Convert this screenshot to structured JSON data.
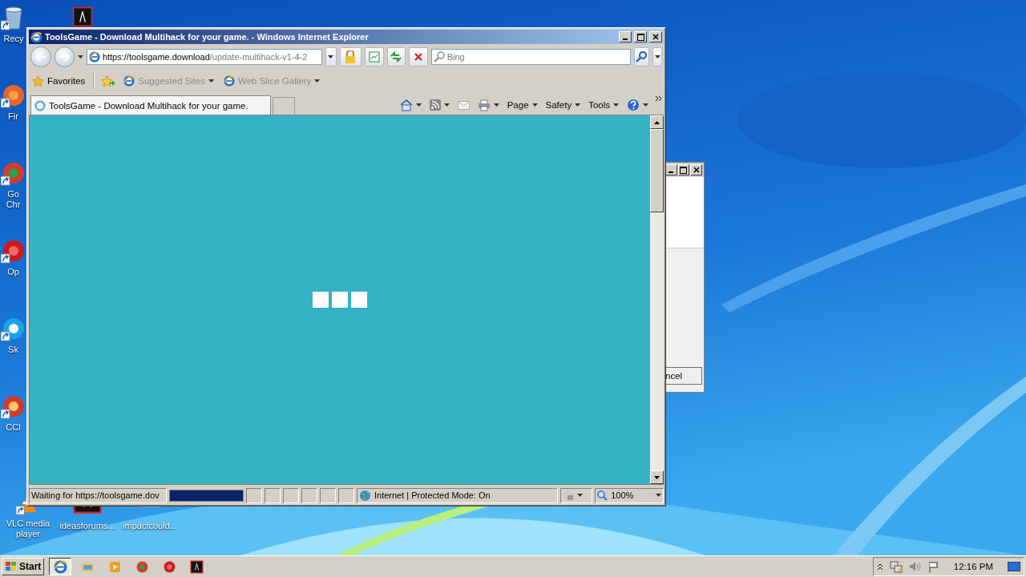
{
  "desktop": {
    "top_icons": [
      {
        "kind": "app"
      }
    ],
    "icons": [
      {
        "kind": "recycle",
        "label": "Recy"
      },
      {
        "kind": "firefox",
        "label": "Fir"
      },
      {
        "kind": "chrome",
        "label": "Go Chr"
      },
      {
        "kind": "opera",
        "label": "Op"
      },
      {
        "kind": "skype",
        "label": "Sk"
      },
      {
        "kind": "cleaner",
        "label": "CCl"
      },
      {
        "kind": "vlc",
        "label": "VLC media player"
      }
    ],
    "bottom_icons": [
      {
        "kind": "app",
        "label": "ideasforums..."
      },
      {
        "kind": "document",
        "label": "impactcould..."
      }
    ]
  },
  "dialog": {
    "button": "ncel"
  },
  "browser": {
    "title": "ToolsGame - Download Multihack for your game. - Windows Internet Explorer",
    "address": {
      "host": "https://toolsgame.download",
      "path": "/update-multihack-v1-4-2"
    },
    "search": {
      "placeholder": "Bing"
    },
    "favorites": {
      "label": "Favorites",
      "links": [
        "Suggested Sites",
        "Web Slice Gallery"
      ]
    },
    "tabs": [
      {
        "label": "ToolsGame - Download Multihack for your game.",
        "selected": true
      }
    ],
    "commands": [
      "Page",
      "Safety",
      "Tools"
    ],
    "status": {
      "text": "Waiting for https://toolsgame.dov",
      "level": 1,
      "zone": "Internet | Protected Mode: On",
      "zoom": "100%"
    }
  },
  "taskbar": {
    "start": "Start",
    "items": [
      {
        "kind": "ie",
        "selected": true
      },
      {
        "kind": "folder",
        "selected": false
      },
      {
        "kind": "media",
        "selected": false
      },
      {
        "kind": "chrome",
        "selected": false
      },
      {
        "kind": "opera",
        "selected": false
      },
      {
        "kind": "app",
        "selected": false
      }
    ],
    "clock": "12:16 PM"
  }
}
